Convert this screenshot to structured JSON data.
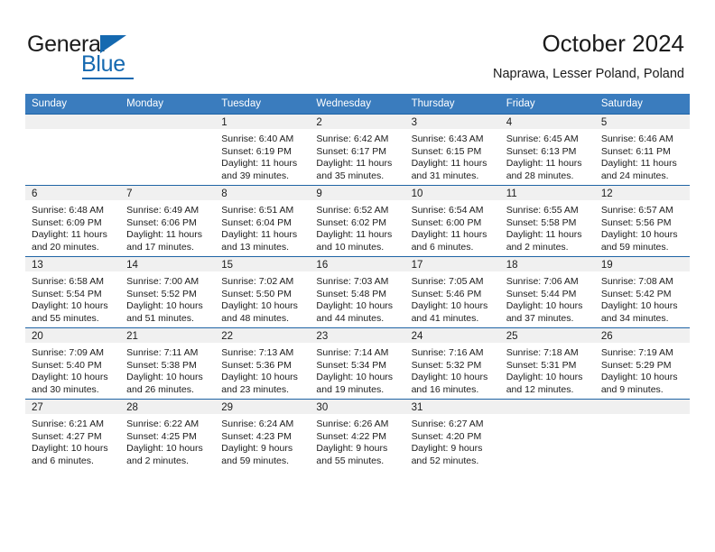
{
  "brand": {
    "name_part1": "General",
    "name_part2": "Blue",
    "triangle_icon": "triangle-icon",
    "accent_color": "#1569b0"
  },
  "header": {
    "title": "October 2024",
    "subtitle": "Naprawa, Lesser Poland, Poland"
  },
  "calendar": {
    "header_background": "#3a7cbe",
    "row_border_color": "#1f64a5",
    "date_strip_background": "#f0f0f0",
    "weekdays": [
      "Sunday",
      "Monday",
      "Tuesday",
      "Wednesday",
      "Thursday",
      "Friday",
      "Saturday"
    ],
    "weeks": [
      [
        {
          "date": "",
          "empty": true
        },
        {
          "date": "",
          "empty": true
        },
        {
          "date": "1",
          "sunrise": "Sunrise: 6:40 AM",
          "sunset": "Sunset: 6:19 PM",
          "daylight_line1": "Daylight: 11 hours",
          "daylight_line2": "and 39 minutes."
        },
        {
          "date": "2",
          "sunrise": "Sunrise: 6:42 AM",
          "sunset": "Sunset: 6:17 PM",
          "daylight_line1": "Daylight: 11 hours",
          "daylight_line2": "and 35 minutes."
        },
        {
          "date": "3",
          "sunrise": "Sunrise: 6:43 AM",
          "sunset": "Sunset: 6:15 PM",
          "daylight_line1": "Daylight: 11 hours",
          "daylight_line2": "and 31 minutes."
        },
        {
          "date": "4",
          "sunrise": "Sunrise: 6:45 AM",
          "sunset": "Sunset: 6:13 PM",
          "daylight_line1": "Daylight: 11 hours",
          "daylight_line2": "and 28 minutes."
        },
        {
          "date": "5",
          "sunrise": "Sunrise: 6:46 AM",
          "sunset": "Sunset: 6:11 PM",
          "daylight_line1": "Daylight: 11 hours",
          "daylight_line2": "and 24 minutes."
        }
      ],
      [
        {
          "date": "6",
          "sunrise": "Sunrise: 6:48 AM",
          "sunset": "Sunset: 6:09 PM",
          "daylight_line1": "Daylight: 11 hours",
          "daylight_line2": "and 20 minutes."
        },
        {
          "date": "7",
          "sunrise": "Sunrise: 6:49 AM",
          "sunset": "Sunset: 6:06 PM",
          "daylight_line1": "Daylight: 11 hours",
          "daylight_line2": "and 17 minutes."
        },
        {
          "date": "8",
          "sunrise": "Sunrise: 6:51 AM",
          "sunset": "Sunset: 6:04 PM",
          "daylight_line1": "Daylight: 11 hours",
          "daylight_line2": "and 13 minutes."
        },
        {
          "date": "9",
          "sunrise": "Sunrise: 6:52 AM",
          "sunset": "Sunset: 6:02 PM",
          "daylight_line1": "Daylight: 11 hours",
          "daylight_line2": "and 10 minutes."
        },
        {
          "date": "10",
          "sunrise": "Sunrise: 6:54 AM",
          "sunset": "Sunset: 6:00 PM",
          "daylight_line1": "Daylight: 11 hours",
          "daylight_line2": "and 6 minutes."
        },
        {
          "date": "11",
          "sunrise": "Sunrise: 6:55 AM",
          "sunset": "Sunset: 5:58 PM",
          "daylight_line1": "Daylight: 11 hours",
          "daylight_line2": "and 2 minutes."
        },
        {
          "date": "12",
          "sunrise": "Sunrise: 6:57 AM",
          "sunset": "Sunset: 5:56 PM",
          "daylight_line1": "Daylight: 10 hours",
          "daylight_line2": "and 59 minutes."
        }
      ],
      [
        {
          "date": "13",
          "sunrise": "Sunrise: 6:58 AM",
          "sunset": "Sunset: 5:54 PM",
          "daylight_line1": "Daylight: 10 hours",
          "daylight_line2": "and 55 minutes."
        },
        {
          "date": "14",
          "sunrise": "Sunrise: 7:00 AM",
          "sunset": "Sunset: 5:52 PM",
          "daylight_line1": "Daylight: 10 hours",
          "daylight_line2": "and 51 minutes."
        },
        {
          "date": "15",
          "sunrise": "Sunrise: 7:02 AM",
          "sunset": "Sunset: 5:50 PM",
          "daylight_line1": "Daylight: 10 hours",
          "daylight_line2": "and 48 minutes."
        },
        {
          "date": "16",
          "sunrise": "Sunrise: 7:03 AM",
          "sunset": "Sunset: 5:48 PM",
          "daylight_line1": "Daylight: 10 hours",
          "daylight_line2": "and 44 minutes."
        },
        {
          "date": "17",
          "sunrise": "Sunrise: 7:05 AM",
          "sunset": "Sunset: 5:46 PM",
          "daylight_line1": "Daylight: 10 hours",
          "daylight_line2": "and 41 minutes."
        },
        {
          "date": "18",
          "sunrise": "Sunrise: 7:06 AM",
          "sunset": "Sunset: 5:44 PM",
          "daylight_line1": "Daylight: 10 hours",
          "daylight_line2": "and 37 minutes."
        },
        {
          "date": "19",
          "sunrise": "Sunrise: 7:08 AM",
          "sunset": "Sunset: 5:42 PM",
          "daylight_line1": "Daylight: 10 hours",
          "daylight_line2": "and 34 minutes."
        }
      ],
      [
        {
          "date": "20",
          "sunrise": "Sunrise: 7:09 AM",
          "sunset": "Sunset: 5:40 PM",
          "daylight_line1": "Daylight: 10 hours",
          "daylight_line2": "and 30 minutes."
        },
        {
          "date": "21",
          "sunrise": "Sunrise: 7:11 AM",
          "sunset": "Sunset: 5:38 PM",
          "daylight_line1": "Daylight: 10 hours",
          "daylight_line2": "and 26 minutes."
        },
        {
          "date": "22",
          "sunrise": "Sunrise: 7:13 AM",
          "sunset": "Sunset: 5:36 PM",
          "daylight_line1": "Daylight: 10 hours",
          "daylight_line2": "and 23 minutes."
        },
        {
          "date": "23",
          "sunrise": "Sunrise: 7:14 AM",
          "sunset": "Sunset: 5:34 PM",
          "daylight_line1": "Daylight: 10 hours",
          "daylight_line2": "and 19 minutes."
        },
        {
          "date": "24",
          "sunrise": "Sunrise: 7:16 AM",
          "sunset": "Sunset: 5:32 PM",
          "daylight_line1": "Daylight: 10 hours",
          "daylight_line2": "and 16 minutes."
        },
        {
          "date": "25",
          "sunrise": "Sunrise: 7:18 AM",
          "sunset": "Sunset: 5:31 PM",
          "daylight_line1": "Daylight: 10 hours",
          "daylight_line2": "and 12 minutes."
        },
        {
          "date": "26",
          "sunrise": "Sunrise: 7:19 AM",
          "sunset": "Sunset: 5:29 PM",
          "daylight_line1": "Daylight: 10 hours",
          "daylight_line2": "and 9 minutes."
        }
      ],
      [
        {
          "date": "27",
          "sunrise": "Sunrise: 6:21 AM",
          "sunset": "Sunset: 4:27 PM",
          "daylight_line1": "Daylight: 10 hours",
          "daylight_line2": "and 6 minutes."
        },
        {
          "date": "28",
          "sunrise": "Sunrise: 6:22 AM",
          "sunset": "Sunset: 4:25 PM",
          "daylight_line1": "Daylight: 10 hours",
          "daylight_line2": "and 2 minutes."
        },
        {
          "date": "29",
          "sunrise": "Sunrise: 6:24 AM",
          "sunset": "Sunset: 4:23 PM",
          "daylight_line1": "Daylight: 9 hours",
          "daylight_line2": "and 59 minutes."
        },
        {
          "date": "30",
          "sunrise": "Sunrise: 6:26 AM",
          "sunset": "Sunset: 4:22 PM",
          "daylight_line1": "Daylight: 9 hours",
          "daylight_line2": "and 55 minutes."
        },
        {
          "date": "31",
          "sunrise": "Sunrise: 6:27 AM",
          "sunset": "Sunset: 4:20 PM",
          "daylight_line1": "Daylight: 9 hours",
          "daylight_line2": "and 52 minutes."
        },
        {
          "date": "",
          "empty": true
        },
        {
          "date": "",
          "empty": true
        }
      ]
    ]
  }
}
